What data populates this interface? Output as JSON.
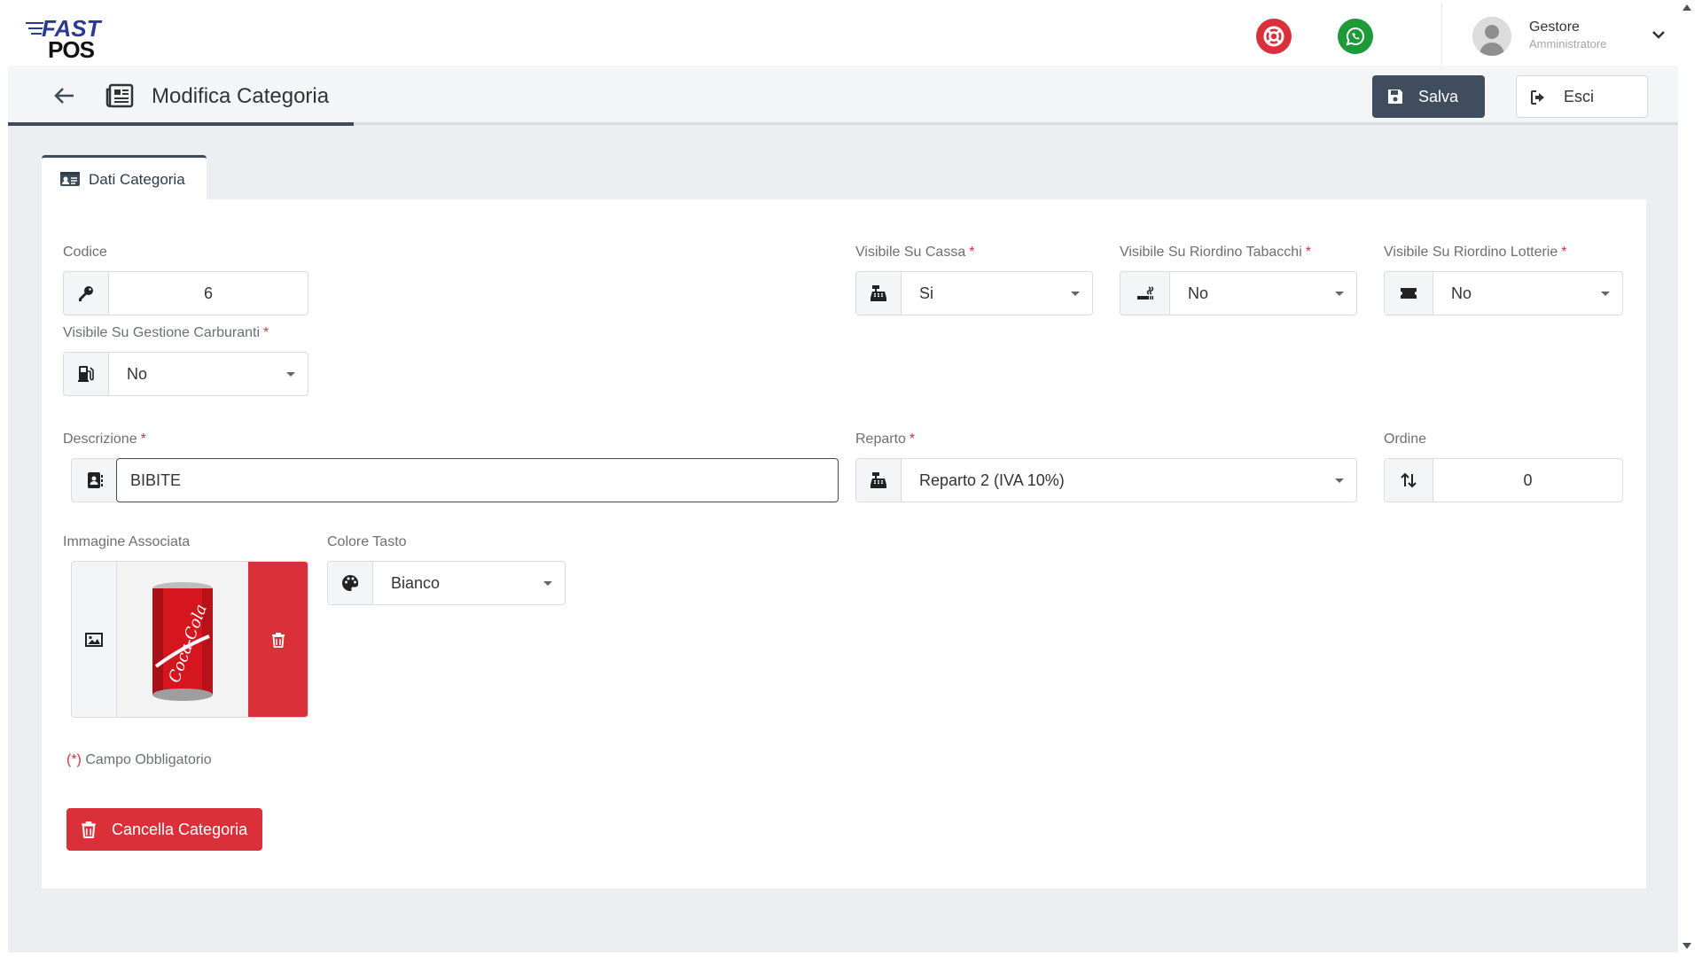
{
  "app": {
    "logo_top": "FAST",
    "logo_bottom": "POS"
  },
  "header": {
    "help_icon": "lifebuoy-icon",
    "whatsapp_icon": "whatsapp-icon",
    "user_name": "Gestore",
    "user_role": "Amministratore"
  },
  "titlebar": {
    "title": "Modifica Categoria",
    "save_label": "Salva",
    "exit_label": "Esci"
  },
  "tabs": [
    {
      "label": "Dati Categoria",
      "icon": "id-card-icon",
      "active": true
    }
  ],
  "form": {
    "codice": {
      "label": "Codice",
      "value": "6"
    },
    "visibile_cassa": {
      "label": "Visibile Su Cassa",
      "required": "*",
      "value": "Si"
    },
    "visibile_tabacchi": {
      "label": "Visibile Su Riordino Tabacchi",
      "required": "*",
      "value": "No"
    },
    "visibile_lotterie": {
      "label": "Visibile Su Riordino Lotterie",
      "required": "*",
      "value": "No"
    },
    "visibile_carburanti": {
      "label": "Visibile Su Gestione Carburanti",
      "required": "*",
      "value": "No"
    },
    "descrizione": {
      "label": "Descrizione",
      "required": "*",
      "value": "BIBITE"
    },
    "reparto": {
      "label": "Reparto",
      "required": "*",
      "value": "Reparto 2 (IVA 10%)"
    },
    "ordine": {
      "label": "Ordine",
      "value": "0"
    },
    "immagine": {
      "label": "Immagine Associata",
      "image": "cola-can-image"
    },
    "colore": {
      "label": "Colore Tasto",
      "value": "Bianco"
    }
  },
  "footnote": {
    "marker": "(*)",
    "text": " Campo Obbligatorio"
  },
  "delete_button": {
    "label": "Cancella Categoria"
  },
  "colors": {
    "primary_dark": "#3f4d5e",
    "danger": "#d9303a",
    "whatsapp": "#1f9a3a"
  }
}
